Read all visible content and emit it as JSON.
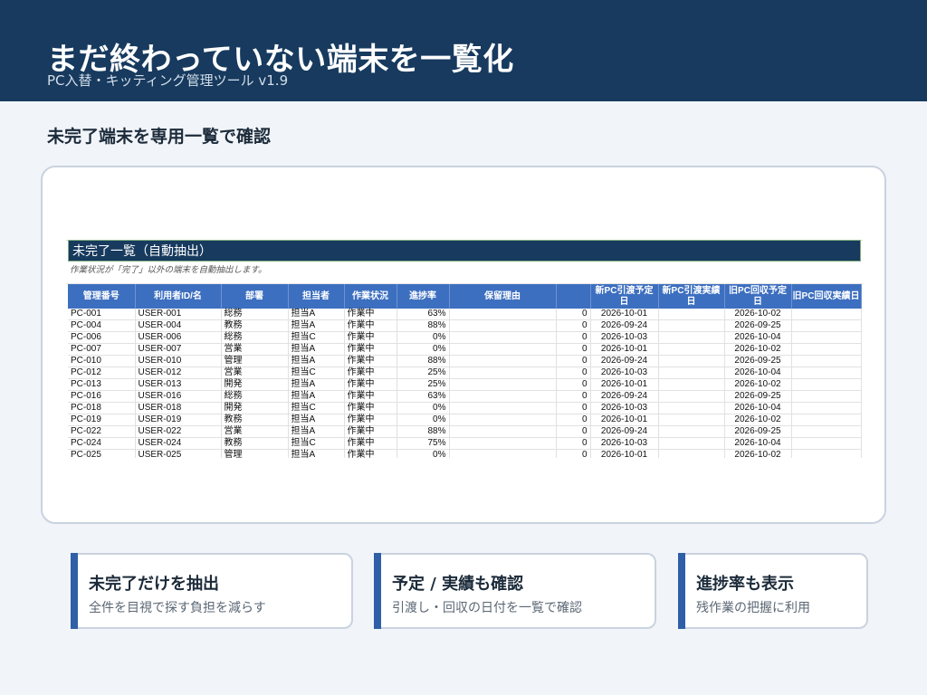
{
  "header": {
    "title": "まだ終わっていない端末を一覧化",
    "subtitle": "PC入替・キッティング管理ツール v1.9"
  },
  "section_title": "未完了端末を専用一覧で確認",
  "sheet": {
    "banner": "未完了一覧（自動抽出）",
    "note": "作業状況が「完了」以外の端末を自動抽出します。",
    "columns": [
      "管理番号",
      "利用者ID/名",
      "部署",
      "担当者",
      "作業状況",
      "進捗率",
      "保留理由",
      "",
      "新PC引渡予定日",
      "新PC引渡実績日",
      "旧PC回収予定日",
      "旧PC回収実績日"
    ],
    "rows": [
      [
        "PC-001",
        "USER-001",
        "総務",
        "担当A",
        "作業中",
        "63%",
        "",
        "0",
        "2026-10-01",
        "",
        "2026-10-02",
        ""
      ],
      [
        "PC-004",
        "USER-004",
        "教務",
        "担当A",
        "作業中",
        "88%",
        "",
        "0",
        "2026-09-24",
        "",
        "2026-09-25",
        ""
      ],
      [
        "PC-006",
        "USER-006",
        "総務",
        "担当C",
        "作業中",
        "0%",
        "",
        "0",
        "2026-10-03",
        "",
        "2026-10-04",
        ""
      ],
      [
        "PC-007",
        "USER-007",
        "営業",
        "担当A",
        "作業中",
        "0%",
        "",
        "0",
        "2026-10-01",
        "",
        "2026-10-02",
        ""
      ],
      [
        "PC-010",
        "USER-010",
        "管理",
        "担当A",
        "作業中",
        "88%",
        "",
        "0",
        "2026-09-24",
        "",
        "2026-09-25",
        ""
      ],
      [
        "PC-012",
        "USER-012",
        "営業",
        "担当C",
        "作業中",
        "25%",
        "",
        "0",
        "2026-10-03",
        "",
        "2026-10-04",
        ""
      ],
      [
        "PC-013",
        "USER-013",
        "開発",
        "担当A",
        "作業中",
        "25%",
        "",
        "0",
        "2026-10-01",
        "",
        "2026-10-02",
        ""
      ],
      [
        "PC-016",
        "USER-016",
        "総務",
        "担当A",
        "作業中",
        "63%",
        "",
        "0",
        "2026-09-24",
        "",
        "2026-09-25",
        ""
      ],
      [
        "PC-018",
        "USER-018",
        "開発",
        "担当C",
        "作業中",
        "0%",
        "",
        "0",
        "2026-10-03",
        "",
        "2026-10-04",
        ""
      ],
      [
        "PC-019",
        "USER-019",
        "教務",
        "担当A",
        "作業中",
        "0%",
        "",
        "0",
        "2026-10-01",
        "",
        "2026-10-02",
        ""
      ],
      [
        "PC-022",
        "USER-022",
        "営業",
        "担当A",
        "作業中",
        "88%",
        "",
        "0",
        "2026-09-24",
        "",
        "2026-09-25",
        ""
      ],
      [
        "PC-024",
        "USER-024",
        "教務",
        "担当C",
        "作業中",
        "75%",
        "",
        "0",
        "2026-10-03",
        "",
        "2026-10-04",
        ""
      ],
      [
        "PC-025",
        "USER-025",
        "管理",
        "担当A",
        "作業中",
        "0%",
        "",
        "0",
        "2026-10-01",
        "",
        "2026-10-02",
        ""
      ]
    ]
  },
  "cards": [
    {
      "title": "未完了だけを抽出",
      "desc": "全件を目視で探す負担を減らす"
    },
    {
      "title": "予定 / 実績も確認",
      "desc": "引渡し・回収の日付を一覧で確認"
    },
    {
      "title": "進捗率も表示",
      "desc": "残作業の把握に利用"
    }
  ],
  "colors": {
    "header_bg": "#173a5e",
    "table_header_bg": "#3d6fc0",
    "card_accent": "#2f5fa7",
    "page_bg": "#f1f4f9"
  }
}
